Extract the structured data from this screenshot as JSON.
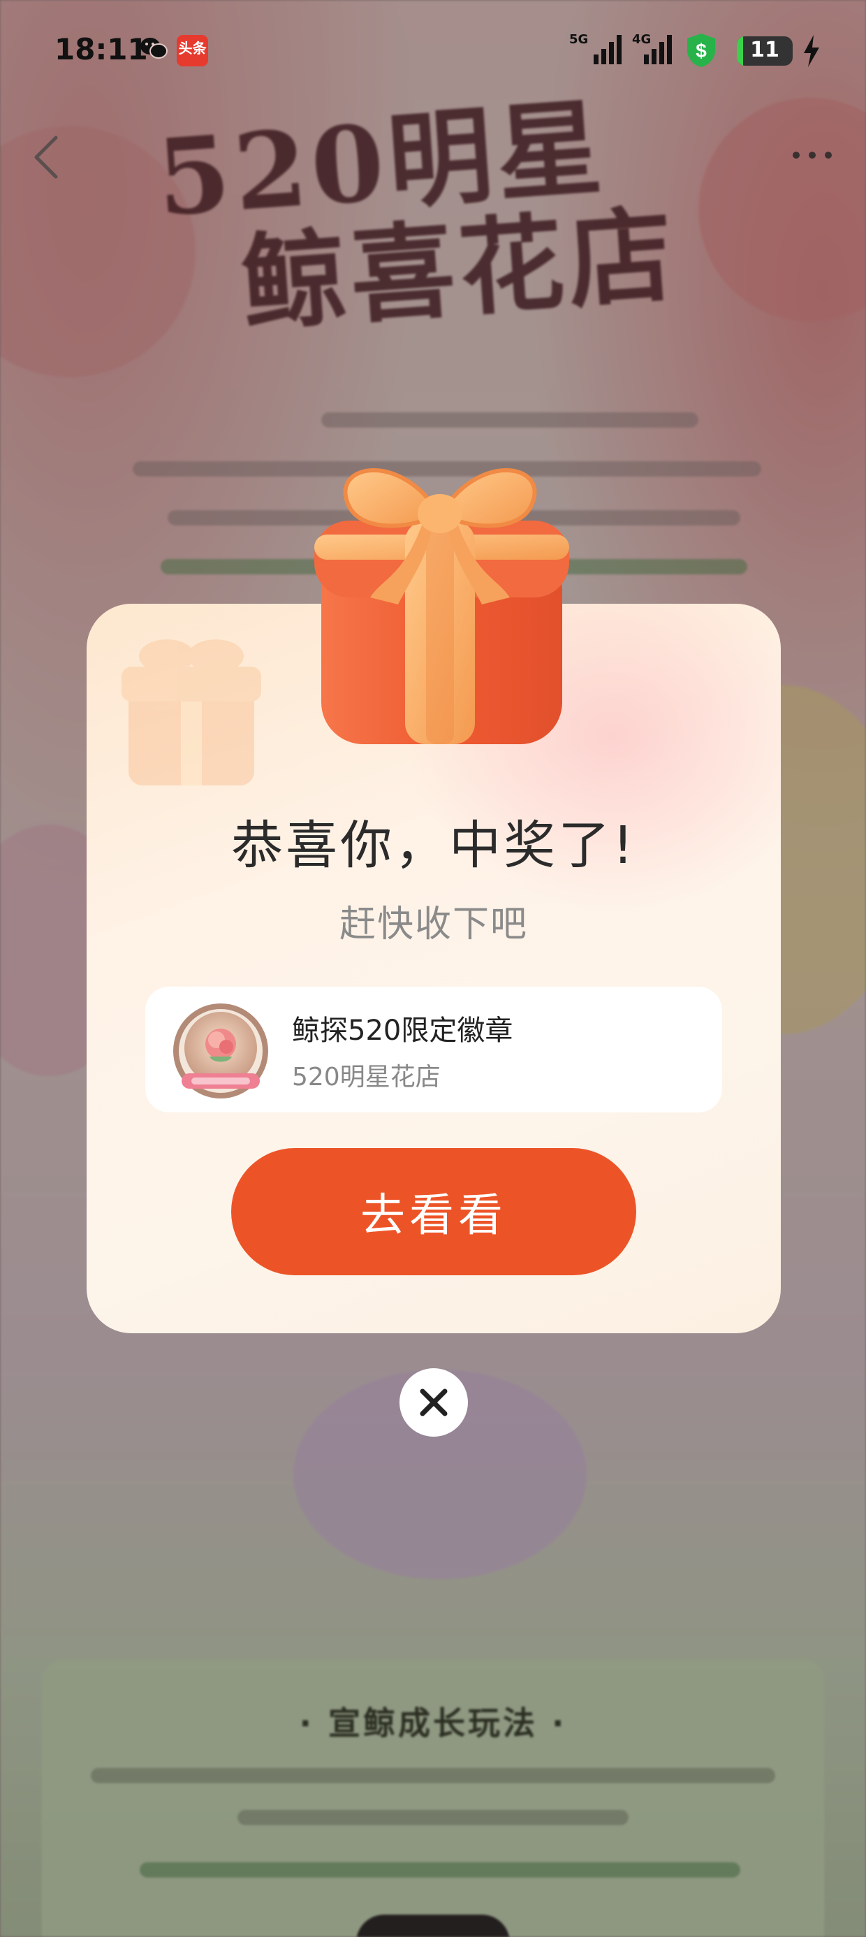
{
  "status_bar": {
    "time": "18:11",
    "network_1": "5G",
    "network_2": "4G",
    "battery_level": "11",
    "battery_fraction": 0.11,
    "toutiao_label": "头条",
    "icons": [
      "wechat-icon",
      "toutiao-app-icon",
      "signal-icon",
      "vpn-shield-icon",
      "battery-icon",
      "charging-bolt-icon"
    ]
  },
  "page": {
    "hero_title_line1": "520明星",
    "hero_title_line2": "鲸喜花店",
    "bottom_card_heading": "· 宣鲸成长玩法 ·"
  },
  "modal": {
    "title": "恭喜你，中奖了!",
    "subtitle": "赶快收下吧",
    "prize": {
      "name": "鲸探520限定徽章",
      "shop": "520明星花店"
    },
    "cta_label": "去看看"
  },
  "colors": {
    "accent": "#ec5428",
    "modal_bg": "#fdf3ea",
    "title_text": "#2b2b2b",
    "muted_text": "#8a8a8a"
  }
}
